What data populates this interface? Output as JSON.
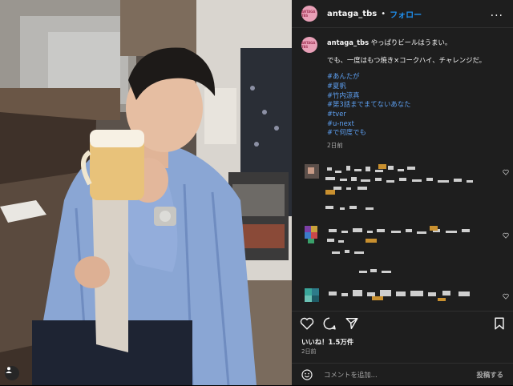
{
  "header": {
    "avatar_text": "ANTAGA TBS",
    "username": "antaga_tbs",
    "separator": "•",
    "follow_label": "フォロー",
    "more_label": "..."
  },
  "caption": {
    "username": "antaga_tbs",
    "line1": "やっぱりビールはうまい。",
    "line2": "でも、一度はもつ焼き×コークハイ、チャレンジだ。",
    "hashtags": [
      "#あんたが",
      "#夏帆",
      "#竹内涼真",
      "#第3話までまてないあなた",
      "#tver",
      "#u-next",
      "#で何度でも"
    ],
    "time": "2日前"
  },
  "actions": {
    "likes": "いいね！1.5万件",
    "date": "2日前"
  },
  "comment_box": {
    "placeholder": "コメントを追加...",
    "post_label": "投稿する"
  },
  "colors": {
    "panel": "#1e1e1e",
    "link": "#5d9ff0",
    "follow": "#1f8fef",
    "avatar": "#e8a0b7"
  },
  "icons": [
    "more-icon",
    "heart-icon",
    "comment-icon",
    "share-icon",
    "bookmark-icon",
    "emoji-icon",
    "user-tag-icon"
  ]
}
